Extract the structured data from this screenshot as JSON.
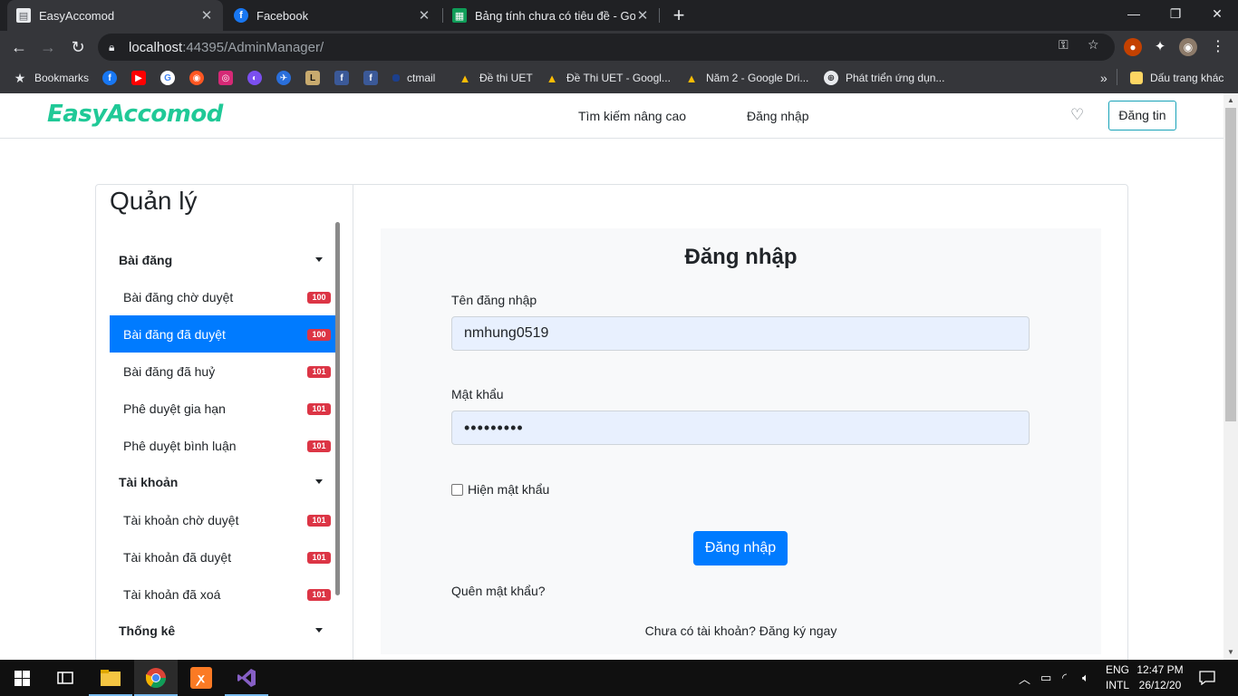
{
  "browser": {
    "tabs": [
      {
        "title": "EasyAccomod",
        "icon": "document-icon",
        "active": true
      },
      {
        "title": "Facebook",
        "icon": "facebook-icon",
        "active": false
      },
      {
        "title": "Bảng tính chưa có tiêu đề - Goog",
        "icon": "google-sheets-icon",
        "active": false
      }
    ],
    "url_host": "localhost",
    "url_rest": ":44395/AdminManager/",
    "bookmarks": [
      {
        "label": "Bookmarks",
        "icon": "star-icon"
      },
      {
        "label": "ctmail",
        "icon": "ctmail-icon"
      },
      {
        "label": "Đề thi UET",
        "icon": "google-drive-icon"
      },
      {
        "label": "Đề Thi UET - Googl...",
        "icon": "google-drive-icon"
      },
      {
        "label": "Năm 2 - Google Dri...",
        "icon": "google-drive-icon"
      },
      {
        "label": "Phát triển ứng dụn...",
        "icon": "globe-icon"
      }
    ],
    "other_bookmarks": "Dấu trang khác"
  },
  "site": {
    "brand": "EasyAccomod",
    "nav": [
      "Tìm kiếm nâng cao",
      "Đăng nhập"
    ],
    "post_button": "Đăng tin"
  },
  "sidebar": {
    "title": "Quản lý",
    "groups": [
      {
        "label": "Bài đăng",
        "items": [
          {
            "label": "Bài đăng chờ duyệt",
            "count": "100",
            "active": false
          },
          {
            "label": "Bài đăng đã duyệt",
            "count": "100",
            "active": true
          },
          {
            "label": "Bài đăng đã huỷ",
            "count": "101",
            "active": false
          },
          {
            "label": "Phê duyệt gia hạn",
            "count": "101",
            "active": false
          },
          {
            "label": "Phê duyệt bình luận",
            "count": "101",
            "active": false
          }
        ]
      },
      {
        "label": "Tài khoản",
        "items": [
          {
            "label": "Tài khoản chờ duyệt",
            "count": "101",
            "active": false
          },
          {
            "label": "Tài khoản đã duyệt",
            "count": "101",
            "active": false
          },
          {
            "label": "Tài khoản đã xoá",
            "count": "101",
            "active": false
          }
        ]
      },
      {
        "label": "Thống kê",
        "items": []
      }
    ]
  },
  "login": {
    "title": "Đăng nhập",
    "username_label": "Tên đăng nhập",
    "username_value": "nmhung0519",
    "password_label": "Mật khẩu",
    "password_value": "•••••••••",
    "show_password_label": "Hiện mật khẩu",
    "submit_label": "Đăng nhập",
    "forgot_label": "Quên mật khẩu?",
    "signup_text": "Chưa có tài khoản? Đăng ký ngay"
  },
  "taskbar": {
    "lang_top": "ENG",
    "lang_bottom": "INTL",
    "time": "12:47 PM",
    "date": "26/12/20"
  },
  "colors": {
    "brand": "#20c997",
    "primary": "#007bff",
    "badge": "#dc3545"
  }
}
